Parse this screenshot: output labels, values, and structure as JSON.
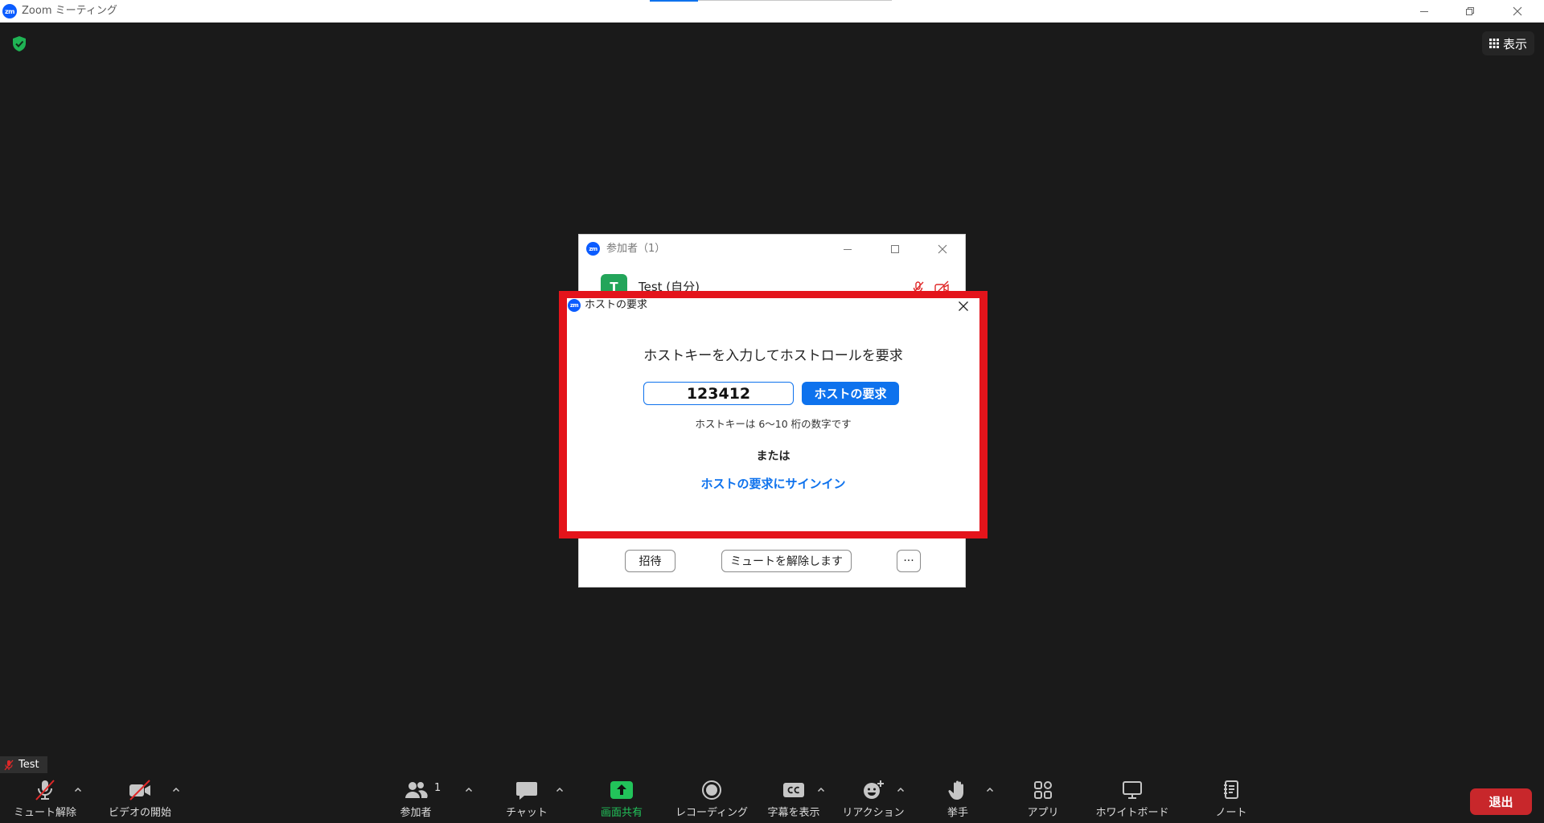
{
  "window": {
    "logo_text": "zm",
    "title": "Zoom ミーティング",
    "controls": {
      "minimize_icon": "minimize-icon",
      "restore_icon": "restore-icon",
      "close_icon": "close-icon"
    }
  },
  "meeting": {
    "security_icon": "shield-check-icon",
    "view_button": {
      "label": "表示",
      "icon": "grid-icon"
    }
  },
  "participants_panel": {
    "logo_text": "zm",
    "title": "参加者（1）",
    "participant": {
      "avatar_letter": "T",
      "name": "Test (自分)",
      "audio_icon": "mic-muted-icon",
      "video_icon": "video-off-icon"
    },
    "buttons": {
      "invite": "招待",
      "unmute": "ミュートを解除します",
      "more": "···"
    }
  },
  "host_dialog": {
    "logo_text": "zm",
    "title": "ホストの要求",
    "heading": "ホストキーを入力してホストロールを要求",
    "host_key": "123412",
    "claim_button": "ホストの要求",
    "hint": "ホストキーは 6～10 桁の数字です",
    "or_text": "または",
    "sign_in_link": "ホストの要求にサインイン"
  },
  "self_view": {
    "name": "Test",
    "audio_icon": "mic-muted-icon"
  },
  "toolbar": {
    "items": [
      {
        "label": "ミュート解除",
        "icon": "mic-muted-icon",
        "has_menu": true
      },
      {
        "label": "ビデオの開始",
        "icon": "video-off-icon",
        "has_menu": true
      },
      {
        "label": "参加者",
        "icon": "participants-icon",
        "has_menu": true
      },
      {
        "label": "チャット",
        "icon": "chat-icon",
        "has_menu": true
      },
      {
        "label": "画面共有",
        "icon": "share-screen-icon",
        "has_menu": false
      },
      {
        "label": "レコーディング",
        "icon": "record-icon",
        "has_menu": false
      },
      {
        "label": "字幕を表示",
        "icon": "captions-icon",
        "has_menu": true
      },
      {
        "label": "リアクション",
        "icon": "reactions-icon",
        "has_menu": true
      },
      {
        "label": "挙手",
        "icon": "raise-hand-icon",
        "has_menu": true
      },
      {
        "label": "アプリ",
        "icon": "apps-icon",
        "has_menu": false
      },
      {
        "label": "ホワイトボード",
        "icon": "whiteboard-icon",
        "has_menu": false
      },
      {
        "label": "ノート",
        "icon": "notes-icon",
        "has_menu": false
      }
    ],
    "participants_count": "1",
    "leave_label": "退出"
  },
  "colors": {
    "meeting_bg": "#1a1a1a",
    "zoom_blue": "#0b5cff",
    "accent_blue": "#0e72ed",
    "highlight_red": "#e4141b",
    "share_green": "#22c35a",
    "leave_red": "#c8272b",
    "avatar_green": "#23a55a",
    "muted_red": "#e02828"
  }
}
